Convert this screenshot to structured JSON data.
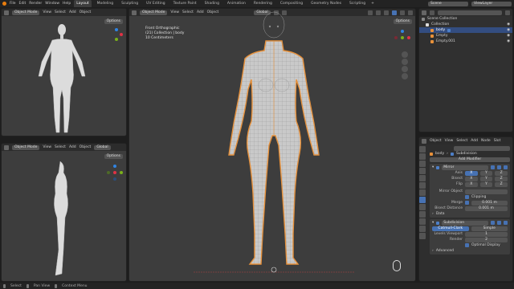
{
  "topbar": {
    "menus": [
      "File",
      "Edit",
      "Render",
      "Window",
      "Help"
    ],
    "tabs": [
      "Layout",
      "Modeling",
      "Sculpting",
      "UV Editing",
      "Texture Paint",
      "Shading",
      "Animation",
      "Rendering",
      "Compositing",
      "Geometry Nodes",
      "Scripting"
    ],
    "active_tab": "Layout",
    "scene_label": "Scene",
    "view_layer_label": "ViewLayer"
  },
  "viewport_front": {
    "mode": "Object Mode",
    "menus": [
      "View",
      "Select",
      "Add",
      "Object"
    ],
    "options_label": "Options"
  },
  "viewport_side": {
    "mode": "Object Mode",
    "menus": [
      "View",
      "Select",
      "Add",
      "Object"
    ],
    "transform": "Global",
    "options_label": "Options"
  },
  "viewport_main": {
    "mode": "Object Mode",
    "menus": [
      "View",
      "Select",
      "Add",
      "Object"
    ],
    "transform": "Global",
    "options_label": "Options",
    "info": [
      "Front Orthographic",
      "(21) Collection | body",
      "10 Centimeters"
    ]
  },
  "outliner": {
    "root": "Scene Collection",
    "collection": "Collection",
    "items": [
      "body",
      "Empty",
      "Empty.001"
    ]
  },
  "properties": {
    "header_menus": [
      "Object",
      "View",
      "Select",
      "Add",
      "Node",
      "Slot"
    ],
    "search_placeholder": "",
    "object_name": "body",
    "modifier_name": "Subdivision",
    "add_modifier": "Add Modifier",
    "mirror": {
      "title": "Mirror",
      "axis_label": "Axis",
      "bisect_label": "Bisect",
      "flip_label": "Flip",
      "axes": [
        "X",
        "Y",
        "Z"
      ],
      "mirror_object_label": "Mirror Object",
      "clipping_label": "Clipping",
      "merge_label": "Merge",
      "merge_value": "0.001 m",
      "bisect_distance_label": "Bisect Distance",
      "bisect_distance_value": "0.001 m",
      "data_label": "Data"
    },
    "subdivision": {
      "title": "Subdivision",
      "catmull": "Catmull-Clark",
      "simple": "Simple",
      "levels_viewport_label": "Levels Viewport",
      "levels_viewport_value": "1",
      "render_label": "Render",
      "render_value": "2",
      "optimal_display_label": "Optimal Display",
      "advanced_label": "Advanced"
    }
  },
  "statusbar": [
    "Select",
    "Pan View",
    "Context Menu"
  ],
  "colors": {
    "accent": "#4772b3",
    "selection_outline": "#e8913a",
    "viewport_bg": "#3d3d3d"
  }
}
